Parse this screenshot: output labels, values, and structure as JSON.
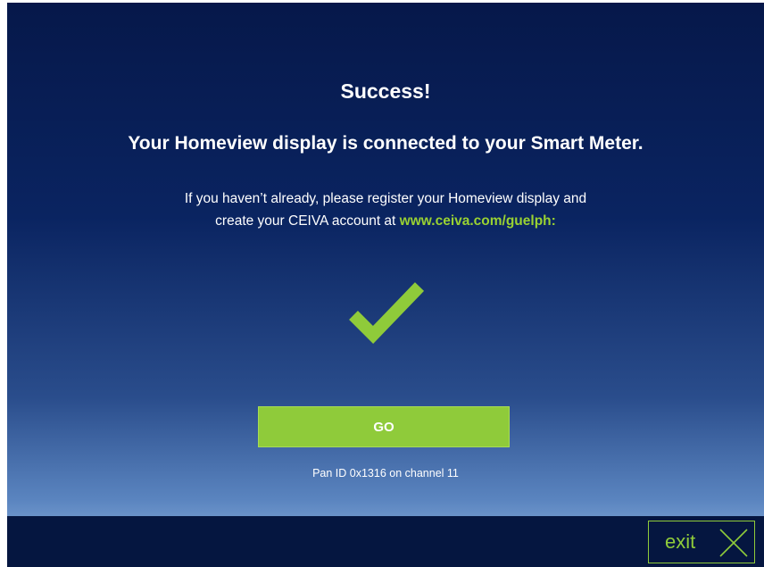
{
  "screen": {
    "title": "Success!",
    "headline": "Your Homeview display is connected to your Smart Meter.",
    "body_line1": "If you haven’t already, please register your Homeview display and",
    "body_line2_prefix": "create your CEIVA account at ",
    "body_link": "www.ceiva.com/guelph",
    "body_colon": ":",
    "go_button_label": "GO",
    "pan_info": "Pan ID 0x1316 on channel 11",
    "exit_label": "exit"
  },
  "icons": {
    "success": "checkmark-icon",
    "exit": "close-x-icon"
  },
  "colors": {
    "accent_green": "#8fcb3a",
    "background_top": "#06184a",
    "background_bottom": "#6f97cc",
    "text": "#ffffff"
  }
}
